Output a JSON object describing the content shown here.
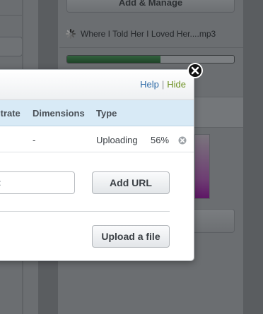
{
  "background": {
    "add_manage_label": "Add & Manage",
    "upload_item": {
      "file_name": "Where I Told Her I Loved Her....mp3",
      "progress_fraction": 0.56
    }
  },
  "dialog": {
    "header": {
      "help_label": "Help",
      "separator": "|",
      "hide_label": "Hide"
    },
    "table": {
      "columns": [
        "itrate",
        "Dimensions",
        "Type"
      ],
      "rows": [
        {
          "dimensions": "-",
          "status": "Uploading",
          "percent": "56%"
        }
      ]
    },
    "url_input": {
      "placeholder": "<",
      "value": ""
    },
    "add_url_label": "Add URL",
    "upload_file_label": "Upload a file"
  },
  "colors": {
    "accent_link": "#2d6aa6",
    "hide_link": "#6a8f1d",
    "table_header_bg": "#d8eaf6",
    "progress_fill": "#2a5a36"
  }
}
